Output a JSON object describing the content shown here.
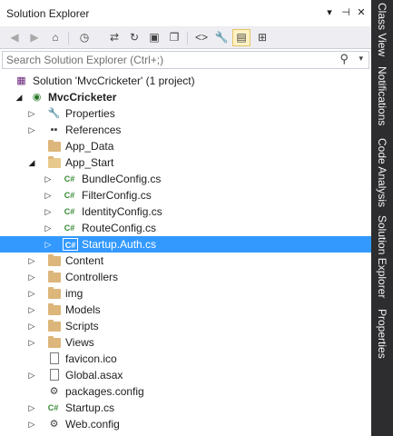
{
  "panel": {
    "title": "Solution Explorer",
    "controls": {
      "dropdown": "▾",
      "pin": "⊣",
      "close": "✕"
    }
  },
  "toolbar": {
    "buttons": [
      {
        "name": "back",
        "glyph": "◀"
      },
      {
        "name": "forward",
        "glyph": "▶"
      },
      {
        "name": "home",
        "glyph": "⌂"
      },
      {
        "name": "pending-changes",
        "glyph": "◷"
      },
      {
        "name": "sync",
        "glyph": "⇄"
      },
      {
        "name": "refresh",
        "glyph": "↻"
      },
      {
        "name": "collapse-all",
        "glyph": "▣"
      },
      {
        "name": "show-all-files",
        "glyph": "❐"
      },
      {
        "name": "view-code",
        "glyph": "<>"
      },
      {
        "name": "properties",
        "glyph": "🔧"
      },
      {
        "name": "preview-selected",
        "glyph": "▤"
      },
      {
        "name": "view-class-diagram",
        "glyph": "⊞"
      }
    ]
  },
  "search": {
    "placeholder": "Search Solution Explorer (Ctrl+;)"
  },
  "tree": {
    "solution": "Solution 'MvcCricketer' (1 project)",
    "project": "MvcCricketer",
    "items": [
      {
        "label": "Properties"
      },
      {
        "label": "References"
      },
      {
        "label": "App_Data"
      },
      {
        "label": "App_Start"
      },
      {
        "label": "BundleConfig.cs"
      },
      {
        "label": "FilterConfig.cs"
      },
      {
        "label": "IdentityConfig.cs"
      },
      {
        "label": "RouteConfig.cs"
      },
      {
        "label": "Startup.Auth.cs"
      },
      {
        "label": "Content"
      },
      {
        "label": "Controllers"
      },
      {
        "label": "img"
      },
      {
        "label": "Models"
      },
      {
        "label": "Scripts"
      },
      {
        "label": "Views"
      },
      {
        "label": "favicon.ico"
      },
      {
        "label": "Global.asax"
      },
      {
        "label": "packages.config"
      },
      {
        "label": "Startup.cs"
      },
      {
        "label": "Web.config"
      }
    ]
  },
  "side_tabs": [
    "Class View",
    "Notifications",
    "Code Analysis",
    "Solution Explorer",
    "Properties"
  ],
  "colors": {
    "selection": "#3399ff",
    "folder": "#dcb67a",
    "csharp": "#388a34",
    "chrome_dark": "#2d2d30"
  }
}
